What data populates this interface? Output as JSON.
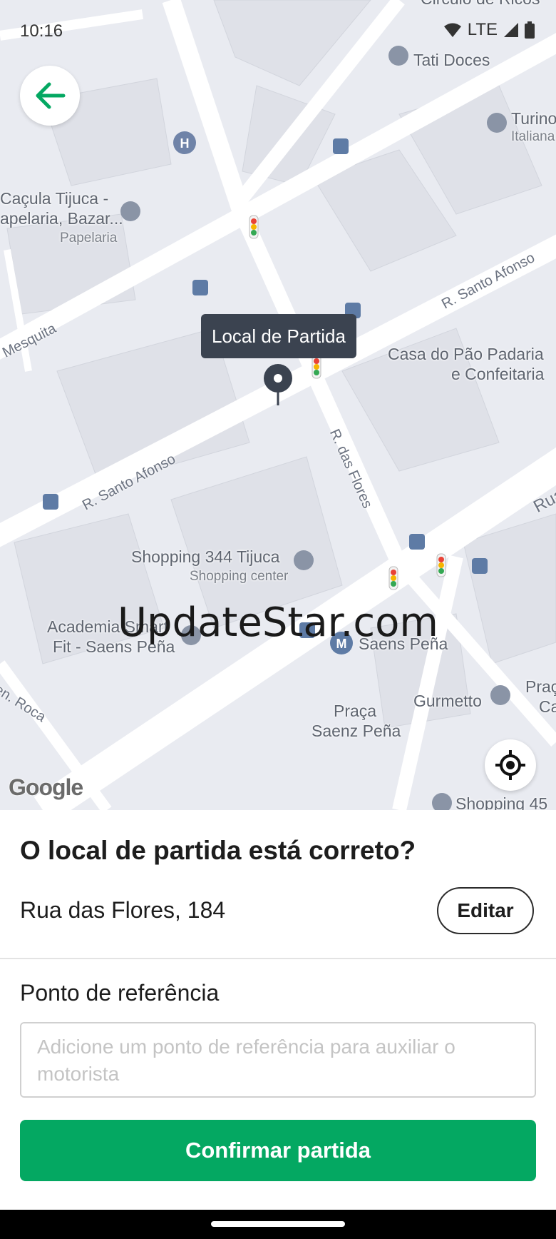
{
  "status_bar": {
    "time": "10:16",
    "network": "LTE"
  },
  "map": {
    "tooltip": "Local de Partida",
    "pois": {
      "tati_doces": "Tati Doces",
      "turino": "Turino",
      "italiana": "Italiana",
      "cacula_line1": "Caçula Tijuca -",
      "cacula_line2": "apelaria, Bazar...",
      "papelaria": "Papelaria",
      "casa_pao_line1": "Casa do Pão Padaria",
      "casa_pao_line2": "e Confeitaria",
      "shopping344": "Shopping 344 Tijuca",
      "shopping_center": "Shopping center",
      "academia_line1": "Academia Smart",
      "academia_line2": "Fit - Saens Peña",
      "saens_pena": "Saens Peña",
      "gurmetto": "Gurmetto",
      "praca_line1": "Praça",
      "praca_line2": "Saenz Peña",
      "praca_right1": "Praç",
      "praca_right2": "Ca",
      "shopping45": "Shopping 45",
      "circulo": "Circulo de Ricos"
    },
    "streets": {
      "santo_afonso_right": "R. Santo Afonso",
      "santo_afonso_left": "R. Santo Afonso",
      "das_flores": "R. das Flores",
      "mesquita": "Mesquita",
      "roca": "en. Roca",
      "rua": "Rua"
    },
    "watermark": "UpdateStar.com",
    "google": "Google"
  },
  "sheet": {
    "question": "O local de partida está correto?",
    "address": "Rua das Flores, 184",
    "edit_label": "Editar",
    "ref_label": "Ponto de referência",
    "ref_placeholder": "Adicione um ponto de referência para auxiliar o motorista",
    "confirm_label": "Confirmar partida"
  },
  "colors": {
    "accent": "#04a862",
    "back_arrow": "#04a862",
    "tooltip_bg": "#3b4350"
  }
}
